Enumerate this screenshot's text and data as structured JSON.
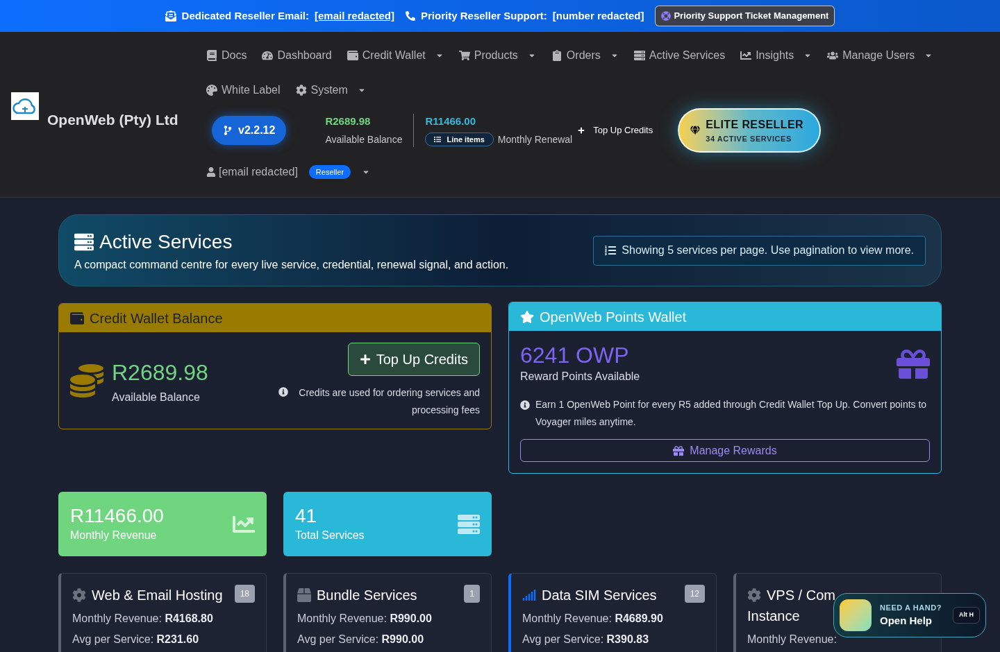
{
  "banner": {
    "email_label": "Dedicated Reseller Email:",
    "email": "[email redacted]",
    "support_label": "Priority Reseller Support:",
    "support": "[number redacted]",
    "ticket_button": "Priority Support Ticket Management"
  },
  "brand": {
    "name": "OpenWeb (Pty) Ltd"
  },
  "nav": {
    "items": [
      {
        "label": "Docs",
        "dropdown": false
      },
      {
        "label": "Dashboard",
        "dropdown": false
      },
      {
        "label": "Credit Wallet",
        "dropdown": true
      },
      {
        "label": "Products",
        "dropdown": true
      },
      {
        "label": "Orders",
        "dropdown": true
      },
      {
        "label": "Active Services",
        "dropdown": false
      },
      {
        "label": "Insights",
        "dropdown": true
      },
      {
        "label": "Manage Users",
        "dropdown": true
      },
      {
        "label": "White Label",
        "dropdown": false
      },
      {
        "label": "System",
        "dropdown": true
      }
    ],
    "version": "v2.2.12",
    "balance": {
      "value": "R2689.98",
      "label": "Available Balance"
    },
    "renewal": {
      "value": "R11466.00",
      "badge": "Line items",
      "label": "Monthly Renewal"
    },
    "top_up": "Top Up Credits",
    "elite": {
      "title": "ELITE RESELLER",
      "subtitle": "34 ACTIVE SERVICES"
    },
    "user": {
      "email": "[email redacted]",
      "role": "Reseller",
      "dropdown": true
    }
  },
  "hero": {
    "title": "Active Services",
    "subtitle": "A compact command centre for every live service, credential, renewal signal, and action.",
    "notice": "Showing 5 services per page. Use pagination to view more."
  },
  "wallet": {
    "title": "Credit Wallet Balance",
    "amount": "R2689.98",
    "label": "Available Balance",
    "button": "Top Up Credits",
    "note": "Credits are used for ordering services and processing fees"
  },
  "points": {
    "title": "OpenWeb Points Wallet",
    "amount": "6241 OWP",
    "label": "Reward Points Available",
    "note": "Earn 1 OpenWeb Point for every R5 added through Credit Wallet Top Up. Convert points to Voyager miles anytime.",
    "button": "Manage Rewards"
  },
  "stats": [
    {
      "value": "R11466.00",
      "label": "Monthly Revenue",
      "color": "#6fd67f"
    },
    {
      "value": "41",
      "label": "Total Services",
      "color": "#29b8d8"
    }
  ],
  "services": [
    {
      "title": "Web & Email Hosting",
      "count": "18",
      "color": "#5c6270",
      "lines": [
        {
          "label": "Monthly Revenue:",
          "value": "R4168.80"
        },
        {
          "label": "Avg per Service:",
          "value": "R231.60"
        }
      ]
    },
    {
      "title": "Bundle Services",
      "count": "1",
      "color": "#5c6270",
      "lines": [
        {
          "label": "Monthly Revenue:",
          "value": "R990.00"
        },
        {
          "label": "Avg per Service:",
          "value": "R990.00"
        }
      ]
    },
    {
      "title": "Data SIM Services",
      "count": "12",
      "color": "#0d6efd",
      "lines": [
        {
          "label": "Monthly Revenue:",
          "value": "R4689.90"
        },
        {
          "label": "Avg per Service:",
          "value": "R390.83"
        }
      ]
    },
    {
      "title": "VPS / Com",
      "title_continued": "Instance",
      "color": "#5c6270",
      "lines": [
        {
          "label": "Monthly Revenue:"
        }
      ]
    }
  ],
  "help": {
    "eyebrow": "NEED A HAND?",
    "label": "Open Help",
    "shortcut": "Alt H"
  }
}
